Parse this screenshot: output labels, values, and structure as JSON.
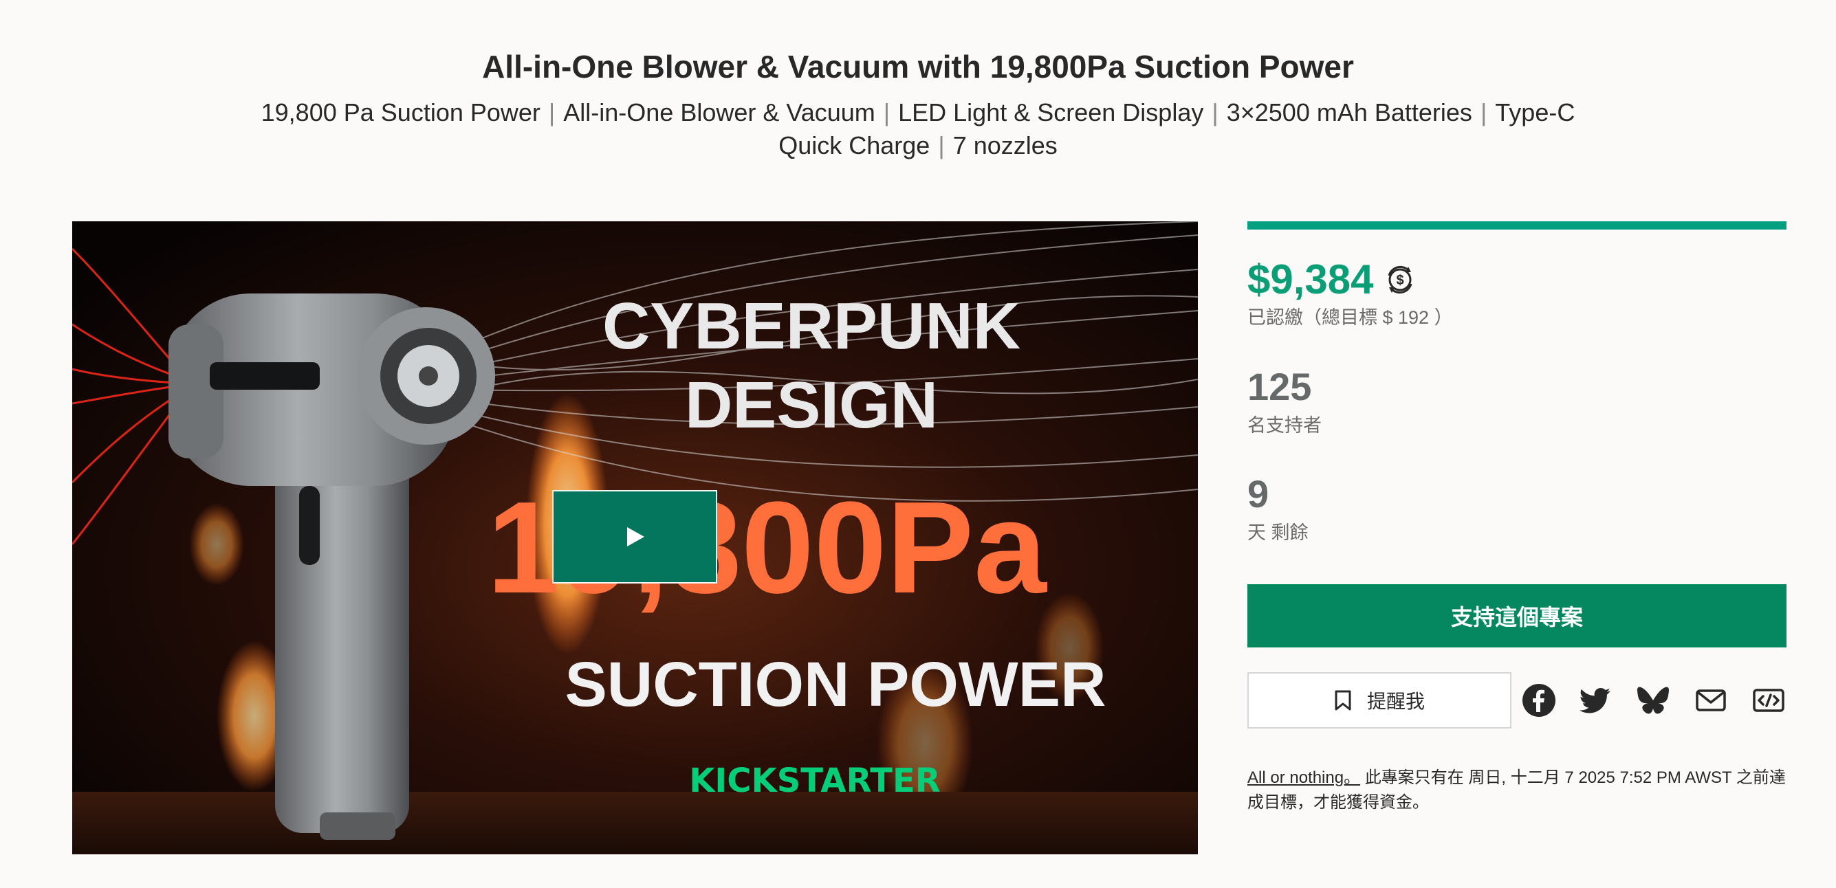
{
  "project": {
    "title": "All-in-One Blower & Vacuum with 19,800Pa Suction Power",
    "features": [
      "19,800 Pa Suction Power",
      "All-in-One Blower & Vacuum",
      "LED Light & Screen Display",
      "3×2500 mAh Batteries",
      "Type-C Quick Charge",
      "7 nozzles"
    ]
  },
  "video": {
    "headline_line1": "CYBERPUNK",
    "headline_line2": "DESIGN",
    "big_value": "19,800Pa",
    "bottom_line": "SUCTION  POWER",
    "brand": "KICKSTARTER"
  },
  "funding": {
    "progress": 1.0,
    "amount": "$9,384",
    "pledged_label": "已認繳（總目標 $ 192 ）",
    "backers": "125",
    "backers_label": "名支持者",
    "days": "9",
    "days_label": "天 剩餘"
  },
  "actions": {
    "back_label": "支持這個專案",
    "remind_label": "提醒我"
  },
  "terms": {
    "link_text": "All or nothing。",
    "text": " 此專案只有在 周日, 十二月 7 2025 7:52 PM AWST 之前達成目標，才能獲得資金。"
  },
  "colors": {
    "accent_green": "#0a9e77",
    "button_green": "#05875f",
    "progress_green": "#05a081",
    "orange": "#ff6f3c",
    "kickstarter_green": "#05ce78"
  }
}
